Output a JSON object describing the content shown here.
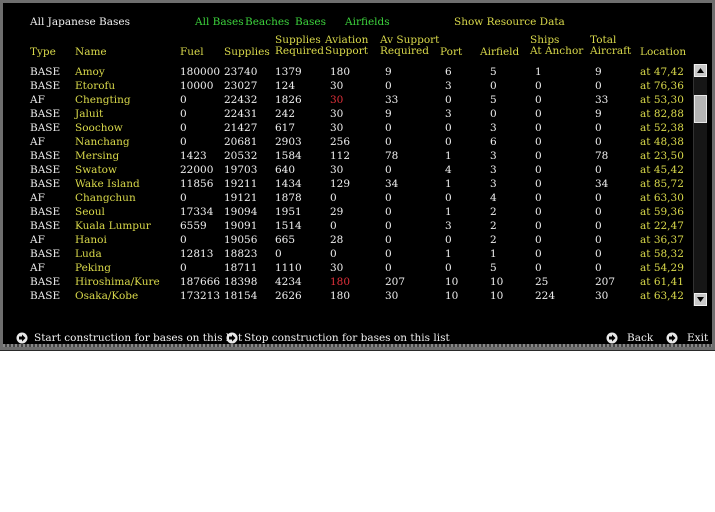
{
  "header": {
    "title": "All Japanese Bases",
    "filters": [
      "All Bases",
      "Beaches",
      "Bases",
      "Airfields"
    ],
    "show_resource": "Show Resource Data"
  },
  "columns": {
    "type": "Type",
    "name": "Name",
    "fuel": "Fuel",
    "supplies": "Supplies",
    "supplies_required": [
      "Supplies",
      "Required"
    ],
    "aviation_support": [
      "Aviation",
      "Support"
    ],
    "av_support_required": [
      "Av Support",
      "Required"
    ],
    "port": "Port",
    "airfield": "Airfield",
    "ships_at_anchor": [
      "Ships",
      "At Anchor"
    ],
    "total_aircraft": [
      "Total",
      "Aircraft"
    ],
    "location": "Location"
  },
  "rows": [
    {
      "type": "BASE",
      "name": "Amoy",
      "fuel": "180000",
      "supplies": "23740",
      "supreq": "1379",
      "avsup": "180",
      "avsup_red": false,
      "avreq": "9",
      "port": "6",
      "airfield": "5",
      "ships": "1",
      "aircraft": "9",
      "location": "at 47,42"
    },
    {
      "type": "BASE",
      "name": "Etorofu",
      "fuel": "10000",
      "supplies": "23027",
      "supreq": "124",
      "avsup": "30",
      "avsup_red": false,
      "avreq": "0",
      "port": "3",
      "airfield": "0",
      "ships": "0",
      "aircraft": "0",
      "location": "at 76,36"
    },
    {
      "type": "AF",
      "name": "Chengting",
      "fuel": "0",
      "supplies": "22432",
      "supreq": "1826",
      "avsup": "30",
      "avsup_red": true,
      "avreq": "33",
      "port": "0",
      "airfield": "5",
      "ships": "0",
      "aircraft": "33",
      "location": "at 53,30"
    },
    {
      "type": "BASE",
      "name": "Jaluit",
      "fuel": "0",
      "supplies": "22431",
      "supreq": "242",
      "avsup": "30",
      "avsup_red": false,
      "avreq": "9",
      "port": "3",
      "airfield": "0",
      "ships": "0",
      "aircraft": "9",
      "location": "at 82,88"
    },
    {
      "type": "BASE",
      "name": "Soochow",
      "fuel": "0",
      "supplies": "21427",
      "supreq": "617",
      "avsup": "30",
      "avsup_red": false,
      "avreq": "0",
      "port": "0",
      "airfield": "3",
      "ships": "0",
      "aircraft": "0",
      "location": "at 52,38"
    },
    {
      "type": "AF",
      "name": "Nanchang",
      "fuel": "0",
      "supplies": "20681",
      "supreq": "2903",
      "avsup": "256",
      "avsup_red": false,
      "avreq": "0",
      "port": "0",
      "airfield": "6",
      "ships": "0",
      "aircraft": "0",
      "location": "at 48,38"
    },
    {
      "type": "BASE",
      "name": "Mersing",
      "fuel": "1423",
      "supplies": "20532",
      "supreq": "1584",
      "avsup": "112",
      "avsup_red": false,
      "avreq": "78",
      "port": "1",
      "airfield": "3",
      "ships": "0",
      "aircraft": "78",
      "location": "at 23,50"
    },
    {
      "type": "BASE",
      "name": "Swatow",
      "fuel": "22000",
      "supplies": "19703",
      "supreq": "640",
      "avsup": "30",
      "avsup_red": false,
      "avreq": "0",
      "port": "4",
      "airfield": "3",
      "ships": "0",
      "aircraft": "0",
      "location": "at 45,42"
    },
    {
      "type": "BASE",
      "name": "Wake Island",
      "fuel": "11856",
      "supplies": "19211",
      "supreq": "1434",
      "avsup": "129",
      "avsup_red": false,
      "avreq": "34",
      "port": "1",
      "airfield": "3",
      "ships": "0",
      "aircraft": "34",
      "location": "at 85,72"
    },
    {
      "type": "AF",
      "name": "Changchun",
      "fuel": "0",
      "supplies": "19121",
      "supreq": "1878",
      "avsup": "0",
      "avsup_red": false,
      "avreq": "0",
      "port": "0",
      "airfield": "4",
      "ships": "0",
      "aircraft": "0",
      "location": "at 63,30"
    },
    {
      "type": "BASE",
      "name": "Seoul",
      "fuel": "17334",
      "supplies": "19094",
      "supreq": "1951",
      "avsup": "29",
      "avsup_red": false,
      "avreq": "0",
      "port": "1",
      "airfield": "2",
      "ships": "0",
      "aircraft": "0",
      "location": "at 59,36"
    },
    {
      "type": "BASE",
      "name": "Kuala Lumpur",
      "fuel": "6559",
      "supplies": "19091",
      "supreq": "1514",
      "avsup": "0",
      "avsup_red": false,
      "avreq": "0",
      "port": "3",
      "airfield": "2",
      "ships": "0",
      "aircraft": "0",
      "location": "at 22,47"
    },
    {
      "type": "AF",
      "name": "Hanoi",
      "fuel": "0",
      "supplies": "19056",
      "supreq": "665",
      "avsup": "28",
      "avsup_red": false,
      "avreq": "0",
      "port": "0",
      "airfield": "2",
      "ships": "0",
      "aircraft": "0",
      "location": "at 36,37"
    },
    {
      "type": "BASE",
      "name": "Luda",
      "fuel": "12813",
      "supplies": "18823",
      "supreq": "0",
      "avsup": "0",
      "avsup_red": false,
      "avreq": "0",
      "port": "1",
      "airfield": "1",
      "ships": "0",
      "aircraft": "0",
      "location": "at 58,32"
    },
    {
      "type": "AF",
      "name": "Peking",
      "fuel": "0",
      "supplies": "18711",
      "supreq": "1110",
      "avsup": "30",
      "avsup_red": false,
      "avreq": "0",
      "port": "0",
      "airfield": "5",
      "ships": "0",
      "aircraft": "0",
      "location": "at 54,29"
    },
    {
      "type": "BASE",
      "name": "Hiroshima/Kure",
      "fuel": "187666",
      "supplies": "18398",
      "supreq": "4234",
      "avsup": "180",
      "avsup_red": true,
      "avreq": "207",
      "port": "10",
      "airfield": "10",
      "ships": "25",
      "aircraft": "207",
      "location": "at 61,41"
    },
    {
      "type": "BASE",
      "name": "Osaka/Kobe",
      "fuel": "173213",
      "supplies": "18154",
      "supreq": "2626",
      "avsup": "180",
      "avsup_red": false,
      "avreq": "30",
      "port": "10",
      "airfield": "10",
      "ships": "224",
      "aircraft": "30",
      "location": "at 63,42"
    }
  ],
  "footer": {
    "start_construction": "Start construction for bases on this list",
    "stop_construction": "Stop construction for bases on this list",
    "back": "Back",
    "exit": "Exit",
    "icons": [
      "arrow-right-icon"
    ]
  },
  "colors": {
    "background": "#000000",
    "text_white": "#f0f0f0",
    "text_yellow": "#d8d84a",
    "filter_green": "#3cd23c",
    "alert_red": "#e0303a"
  }
}
